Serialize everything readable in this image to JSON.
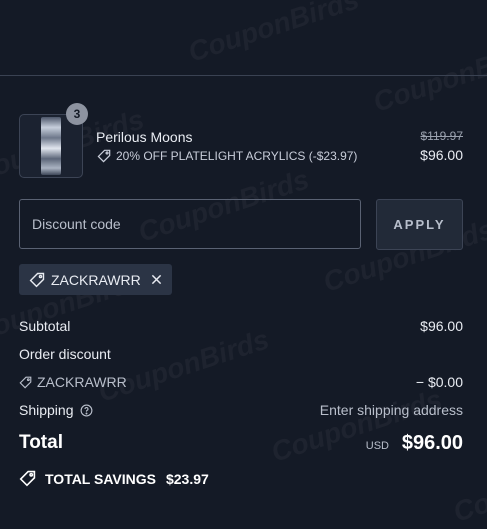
{
  "product": {
    "quantity": "3",
    "name": "Perilous Moons",
    "discount": "20% OFF PLATELIGHT ACRYLICS (-$23.97)",
    "original_price": "$119.97",
    "price": "$96.00"
  },
  "discount_form": {
    "placeholder": "Discount code",
    "apply_label": "APPLY"
  },
  "applied_code": {
    "code": "ZACKRAWRR"
  },
  "summary": {
    "subtotal_label": "Subtotal",
    "subtotal_value": "$96.00",
    "order_discount_label": "Order discount",
    "order_discount_code": "ZACKRAWRR",
    "order_discount_value": "− $0.00",
    "shipping_label": "Shipping",
    "shipping_value": "Enter shipping address",
    "total_label": "Total",
    "total_currency": "USD",
    "total_value": "$96.00",
    "savings_label": "TOTAL SAVINGS",
    "savings_value": "$23.97"
  },
  "watermark": "CouponBirds",
  "colors": {
    "background": "#141a26",
    "chip_background": "#2b3445",
    "apply_button_background": "#222a38"
  },
  "icons": [
    "tag-icon",
    "close-icon",
    "info-icon",
    "savings-tag-icon"
  ]
}
